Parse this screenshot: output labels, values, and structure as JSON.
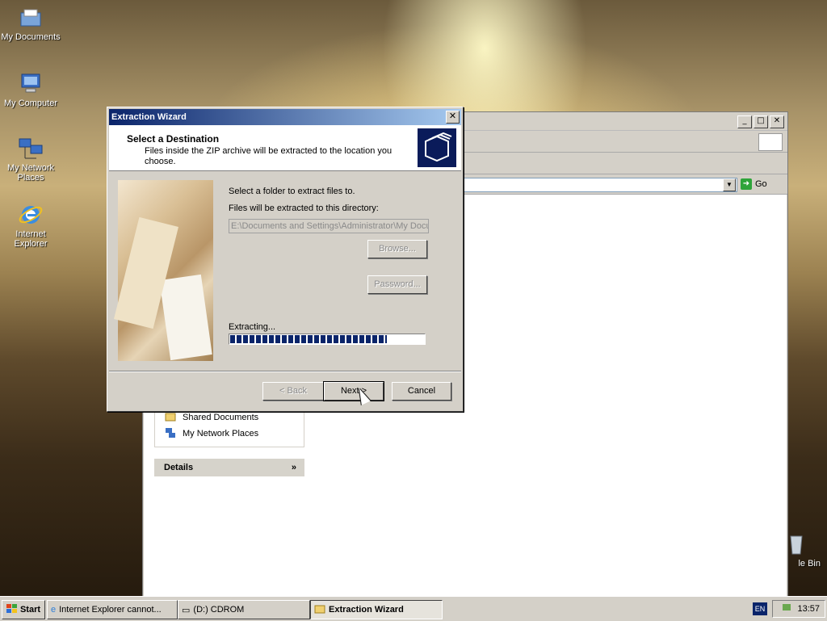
{
  "desktop": {
    "icons": [
      {
        "label": "My Documents",
        "icon": "folder-docs-icon"
      },
      {
        "label": "My Computer",
        "icon": "computer-icon"
      },
      {
        "label": "My Network Places",
        "icon": "network-icon"
      },
      {
        "label": "Internet Explorer",
        "icon": "ie-icon"
      },
      {
        "label": "le Bin",
        "icon": "recycle-bin-icon"
      }
    ]
  },
  "explorer": {
    "go_label": "Go",
    "other_places": [
      {
        "label": "Shared Documents"
      },
      {
        "label": "My Network Places"
      }
    ],
    "details_label": "Details"
  },
  "wizard": {
    "title": "Extraction Wizard",
    "header_title": "Select a Destination",
    "header_subtitle": "Files inside the ZIP archive will be extracted to the location you choose.",
    "select_label": "Select a folder to extract files to.",
    "dir_label": "Files will be extracted to this directory:",
    "path_value": "E:\\Documents and Settings\\Administrator\\My Documents",
    "browse_label": "Browse...",
    "password_label": "Password...",
    "extracting_label": "Extracting...",
    "progress": 0.81,
    "back_label": "< Back",
    "next_label": "Next >",
    "cancel_label": "Cancel"
  },
  "taskbar": {
    "start_label": "Start",
    "tasks": [
      {
        "label": "Internet Explorer cannot...",
        "active": false
      },
      {
        "label": "(D:) CDROM",
        "active": false
      },
      {
        "label": "Extraction Wizard",
        "active": true
      }
    ],
    "lang": "EN",
    "clock": "13:57"
  }
}
